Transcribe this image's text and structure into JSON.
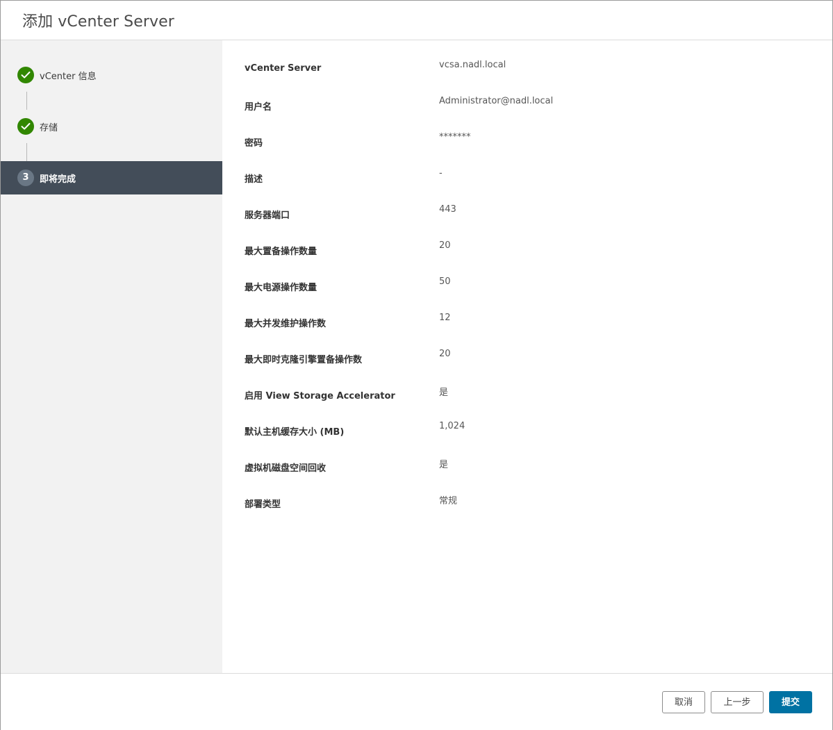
{
  "dialog": {
    "title": "添加 vCenter Server"
  },
  "steps": [
    {
      "number": "1",
      "label": "vCenter 信息",
      "state": "done"
    },
    {
      "number": "2",
      "label": "存储",
      "state": "done"
    },
    {
      "number": "3",
      "label": "即将完成",
      "state": "active"
    }
  ],
  "summary": [
    {
      "key": "vCenter Server",
      "value": "vcsa.nadl.local"
    },
    {
      "key": "用户名",
      "value": "Administrator@nadl.local"
    },
    {
      "key": "密码",
      "value": "*******"
    },
    {
      "key": "描述",
      "value": "-"
    },
    {
      "key": "服务器端口",
      "value": "443"
    },
    {
      "key": "最大置备操作数量",
      "value": "20"
    },
    {
      "key": "最大电源操作数量",
      "value": "50"
    },
    {
      "key": "最大并发维护操作数",
      "value": "12"
    },
    {
      "key": "最大即时克隆引擎置备操作数",
      "value": "20"
    },
    {
      "key": "启用 View Storage Accelerator",
      "value": "是"
    },
    {
      "key": "默认主机缓存大小 (MB)",
      "value": "1,024"
    },
    {
      "key": "虚拟机磁盘空间回收",
      "value": "是"
    },
    {
      "key": "部署类型",
      "value": "常规"
    }
  ],
  "footer": {
    "cancel_label": "取消",
    "back_label": "上一步",
    "submit_label": "提交"
  },
  "colors": {
    "step_done": "#318700",
    "step_active_bg": "#434d59",
    "primary_button": "#0072a3"
  }
}
